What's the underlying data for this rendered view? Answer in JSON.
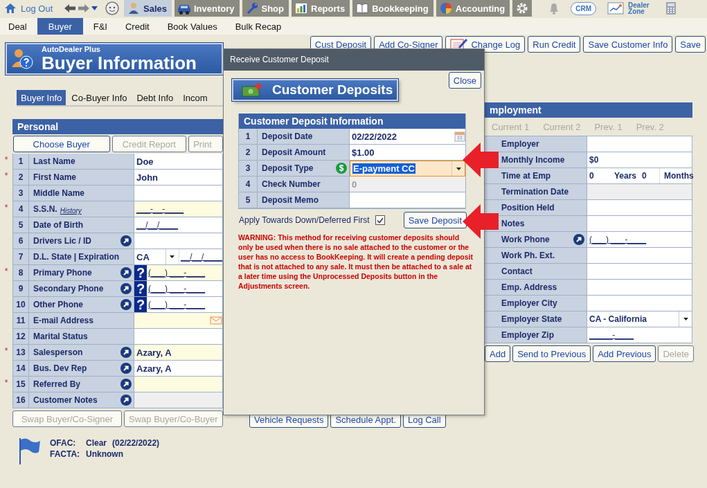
{
  "top_nav": {
    "logout": "Log Out",
    "tabs": [
      {
        "label": "Sales",
        "selected": true
      },
      {
        "label": "Inventory",
        "selected": false
      },
      {
        "label": "Shop",
        "selected": false
      },
      {
        "label": "Reports",
        "selected": false
      },
      {
        "label": "Bookkeeping",
        "selected": false
      },
      {
        "label": "Accounting",
        "selected": false
      }
    ],
    "crm": "CRM",
    "dealer_zone": "Dealer Zone"
  },
  "sub_nav": [
    {
      "label": "Deal",
      "selected": false
    },
    {
      "label": "Buyer",
      "selected": true
    },
    {
      "label": "F&I",
      "selected": false
    },
    {
      "label": "Credit",
      "selected": false
    },
    {
      "label": "Book Values",
      "selected": false
    },
    {
      "label": "Bulk Recap",
      "selected": false
    }
  ],
  "banner": {
    "subtitle": "AutoDealer Plus",
    "title": "Buyer Information"
  },
  "actions": [
    {
      "label": "Cust Deposit",
      "kind": "plain"
    },
    {
      "label": "Add Co-Signer",
      "kind": "plain"
    },
    {
      "label": "Change Log",
      "kind": "log"
    },
    {
      "label": "Run Credit",
      "kind": "plain"
    },
    {
      "label": "Save Customer Info",
      "kind": "plain"
    },
    {
      "label": "Save",
      "kind": "plain"
    }
  ],
  "buyer_tabs": [
    {
      "label": "Buyer Info",
      "selected": true
    },
    {
      "label": "Co-Buyer Info",
      "selected": false
    },
    {
      "label": "Debt Info",
      "selected": false
    },
    {
      "label": "Incom",
      "selected": false
    }
  ],
  "personal": {
    "title": "Personal",
    "buttons": [
      {
        "label": "Choose Buyer",
        "disabled": false
      },
      {
        "label": "Credit Report",
        "disabled": true
      },
      {
        "label": "Print",
        "disabled": true
      }
    ],
    "rows": [
      {
        "required_mark": "*",
        "num": "1",
        "label": "Last Name",
        "link": false,
        "kind": "text",
        "highlighted": false,
        "disabled": false,
        "value": "Doe"
      },
      {
        "required_mark": "*",
        "num": "2",
        "label": "First Name",
        "link": false,
        "kind": "text",
        "highlighted": false,
        "disabled": false,
        "value": "John"
      },
      {
        "num": "3",
        "label": "Middle Name",
        "link": false,
        "kind": "text",
        "highlighted": false,
        "disabled": false
      },
      {
        "required_mark": "*",
        "num": "4",
        "label": "S.S.N.",
        "history": "History",
        "link": false,
        "kind": "mask",
        "highlighted": true,
        "disabled": false,
        "value": "___-__-____"
      },
      {
        "num": "5",
        "label": "Date of Birth",
        "link": false,
        "kind": "mask",
        "highlighted": false,
        "disabled": false,
        "value": "__/__/____"
      },
      {
        "num": "6",
        "label": "Drivers Lic / ID",
        "link": true,
        "kind": "text",
        "highlighted": false,
        "disabled": false
      },
      {
        "num": "7",
        "label": "D.L. State | Expiration",
        "link": false,
        "kind": "state-date",
        "highlighted": false,
        "disabled": false,
        "value": "CA",
        "date": "__/__/____"
      },
      {
        "required_mark": "*",
        "num": "8",
        "label": "Primary Phone",
        "link": true,
        "kind": "phone",
        "highlighted": true,
        "disabled": false,
        "help": "?",
        "value": "(___) ___-____"
      },
      {
        "num": "9",
        "label": "Secondary Phone",
        "link": true,
        "kind": "phone",
        "highlighted": false,
        "disabled": false,
        "help": "?",
        "value": "(___) ___-____"
      },
      {
        "num": "10",
        "label": "Other Phone",
        "link": true,
        "kind": "phone",
        "highlighted": false,
        "disabled": false,
        "help": "?",
        "value": "(___) ___-____"
      },
      {
        "num": "11",
        "label": "E-mail Address",
        "link": false,
        "kind": "email",
        "highlighted": true,
        "disabled": false
      },
      {
        "num": "12",
        "label": "Marital Status",
        "link": false,
        "kind": "text",
        "highlighted": false,
        "disabled": false
      },
      {
        "required_mark": "*",
        "num": "13",
        "label": "Salesperson",
        "link": true,
        "kind": "text",
        "highlighted": true,
        "disabled": false,
        "value": "Azary, A"
      },
      {
        "num": "14",
        "label": "Bus. Dev Rep",
        "link": true,
        "kind": "text",
        "highlighted": false,
        "disabled": false,
        "value": "Azary, A"
      },
      {
        "required_mark": "*",
        "num": "15",
        "label": "Referred By",
        "link": true,
        "kind": "text",
        "highlighted": true,
        "disabled": false
      },
      {
        "num": "16",
        "label": "Customer Notes",
        "link": true,
        "kind": "text",
        "highlighted": false,
        "disabled": true
      }
    ],
    "swap_buttons": [
      {
        "label": "Swap Buyer/Co-Signer",
        "disabled": true
      },
      {
        "label": "Swap Buyer/Co-Buyer",
        "disabled": true
      }
    ]
  },
  "ofac": {
    "ofac_label": "OFAC:",
    "ofac_value": "Clear",
    "ofac_date": "(02/22/2022)",
    "facta_label": "FACTA:",
    "facta_value": "Unknown"
  },
  "middle_buttons": [
    "Vehicle Requests",
    "Schedule Appt.",
    "Log Call"
  ],
  "employment": {
    "title": "mployment",
    "tabs": [
      {
        "label": "Current 1",
        "disabled": true
      },
      {
        "label": "Current 2",
        "disabled": true
      },
      {
        "label": "Prev. 1",
        "disabled": true
      },
      {
        "label": "Prev. 2",
        "disabled": true
      }
    ],
    "rows": [
      {
        "label": "Employer",
        "kind": "text",
        "link": false,
        "disabled": false
      },
      {
        "label": "Monthly Income",
        "kind": "text",
        "link": false,
        "disabled": false,
        "value": "$0"
      },
      {
        "label": "Time at Emp",
        "kind": "duration",
        "link": false,
        "disabled": false,
        "years": "0",
        "years_label": "Years",
        "months": "0",
        "months_label": "Months"
      },
      {
        "label": "Termination Date",
        "kind": "text",
        "link": false,
        "disabled": true
      },
      {
        "label": "Position Held",
        "kind": "text",
        "link": false,
        "disabled": false
      },
      {
        "label": "Notes",
        "kind": "text",
        "link": false,
        "disabled": false
      },
      {
        "label": "Work Phone",
        "kind": "mask",
        "link": true,
        "disabled": false,
        "value": "(___) ___-____"
      },
      {
        "label": "Work Ph. Ext.",
        "kind": "text",
        "link": false,
        "disabled": false
      },
      {
        "label": "Contact",
        "kind": "text",
        "link": false,
        "disabled": false
      },
      {
        "label": "Emp. Address",
        "kind": "text",
        "link": false,
        "disabled": false
      },
      {
        "label": "Employer City",
        "kind": "text",
        "link": false,
        "disabled": false
      },
      {
        "label": "Employer State",
        "kind": "select",
        "link": false,
        "disabled": false,
        "value": "CA - California"
      },
      {
        "label": "Employer Zip",
        "kind": "mask",
        "link": false,
        "disabled": false,
        "value": "_____-____"
      }
    ],
    "buttons": [
      {
        "label": "Add",
        "disabled": false
      },
      {
        "label": "Send to Previous",
        "disabled": false
      },
      {
        "label": "Add Previous",
        "disabled": false
      },
      {
        "label": "Delete",
        "disabled": true
      }
    ]
  },
  "modal": {
    "title": "Receive Customer Deposit",
    "close": "Close",
    "banner": "Customer Deposits",
    "section": "Customer Deposit Information",
    "rows": [
      {
        "num": "1",
        "label": "Deposit Date",
        "kind": "date",
        "value": "02/22/2022"
      },
      {
        "num": "2",
        "label": "Deposit Amount",
        "kind": "text",
        "value": "$1.00"
      },
      {
        "num": "3",
        "label": "Deposit Type",
        "kind": "select",
        "icon_text": "$",
        "value": "E-payment CC"
      },
      {
        "num": "4",
        "label": "Check Number",
        "kind": "disabled",
        "value": "0"
      },
      {
        "num": "5",
        "label": "Deposit Memo",
        "kind": "text"
      }
    ],
    "apply_label": "Apply Towards Down/Deferred First",
    "apply_checked": true,
    "save": "Save Deposit",
    "warning": "WARNING: This method for receiving customer deposits should only be used when there is no sale attached to the customer or the user has no access to BookKeeping. It will create a pending deposit that is not attached to any sale. It must then be attached to a sale at a later time using the Unprocessed Deposits button in the Adjustments screen."
  }
}
